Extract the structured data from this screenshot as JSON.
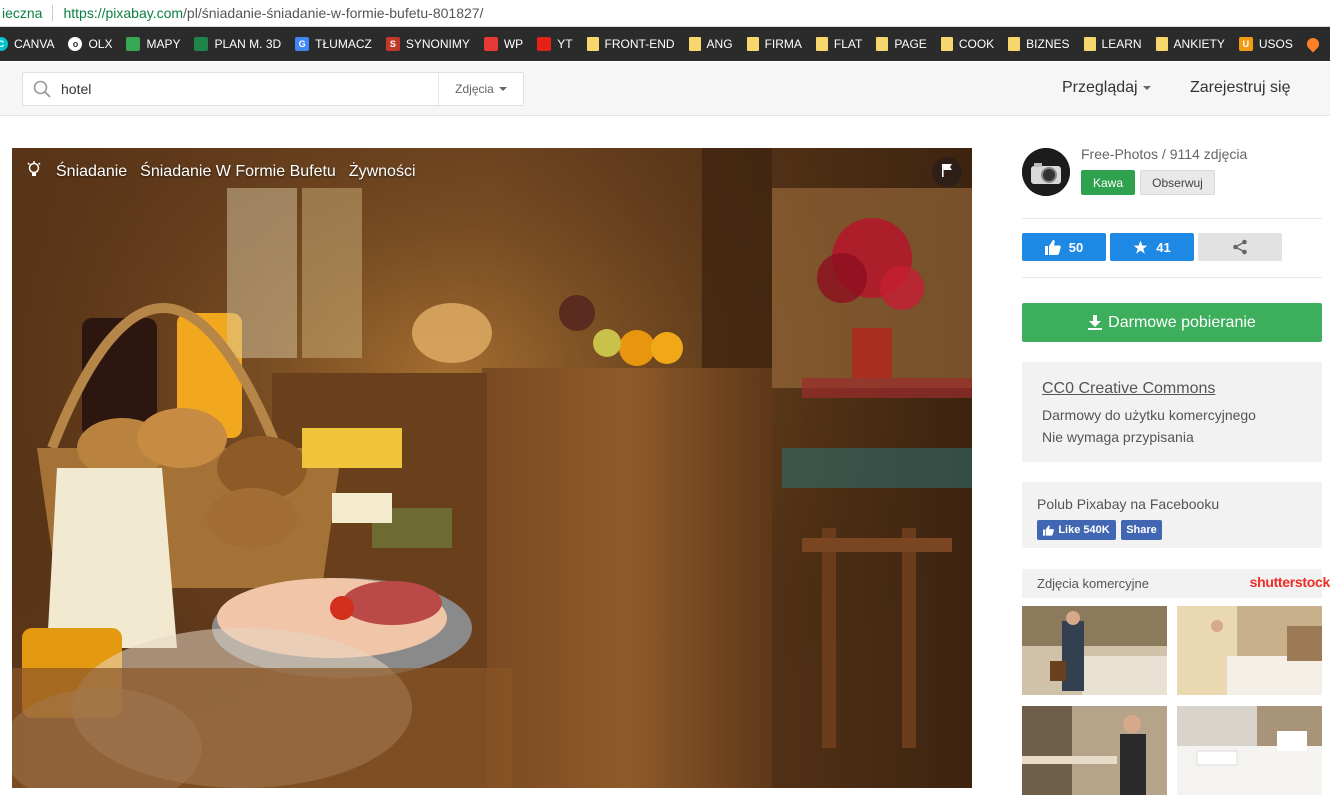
{
  "browser": {
    "security_fragment": "ieczna",
    "url_host": "https://pixabay.com",
    "url_path": "/pl/śniadanie-śniadanie-w-formie-bufetu-801827/"
  },
  "bookmarks": [
    {
      "label": "CANVA",
      "icon": "canva-icon",
      "color": "#00c4cc"
    },
    {
      "label": "OLX",
      "icon": "olx-icon",
      "color": "#ffffff"
    },
    {
      "label": "MAPY",
      "icon": "maps-icon",
      "color": "#34a853"
    },
    {
      "label": "PLAN M. 3D",
      "icon": "plan-icon",
      "color": "#1e8449"
    },
    {
      "label": "TŁUMACZ",
      "icon": "translate-icon",
      "color": "#4285f4"
    },
    {
      "label": "SYNONIMY",
      "icon": "synonimy-icon",
      "color": "#c0392b"
    },
    {
      "label": "WP",
      "icon": "wp-icon",
      "color": "#e53935"
    },
    {
      "label": "YT",
      "icon": "youtube-icon",
      "color": "#e62117"
    },
    {
      "label": "FRONT-END",
      "icon": "folder-icon"
    },
    {
      "label": "ANG",
      "icon": "folder-icon"
    },
    {
      "label": "FIRMA",
      "icon": "folder-icon"
    },
    {
      "label": "FLAT",
      "icon": "folder-icon"
    },
    {
      "label": "PAGE",
      "icon": "folder-icon"
    },
    {
      "label": "COOK",
      "icon": "folder-icon"
    },
    {
      "label": "BIZNES",
      "icon": "folder-icon"
    },
    {
      "label": "LEARN",
      "icon": "folder-icon"
    },
    {
      "label": "ANKIETY",
      "icon": "folder-icon"
    },
    {
      "label": "USOS",
      "icon": "usos-icon",
      "color": "#f39c12"
    }
  ],
  "search": {
    "query": "hotel",
    "type_label": "Zdjęcia"
  },
  "nav": {
    "browse": "Przeglądaj",
    "register": "Zarejestruj się"
  },
  "photo": {
    "tags": [
      "Śniadanie",
      "Śniadanie W Formie Bufetu",
      "Żywności"
    ]
  },
  "author": {
    "name_line": "Free-Photos / 9114 zdjęcia",
    "coffee_label": "Kawa",
    "follow_label": "Obserwuj"
  },
  "stats": {
    "likes": "50",
    "favorites": "41"
  },
  "download": {
    "label": "Darmowe pobieranie"
  },
  "license": {
    "title": "CC0 Creative Commons",
    "line1": "Darmowy do użytku komercyjnego",
    "line2": "Nie wymaga przypisania"
  },
  "facebook": {
    "title": "Polub Pixabay na Facebooku",
    "like_label": "Like 540K",
    "share_label": "Share"
  },
  "commercial": {
    "title": "Zdjęcia komercyjne",
    "brand": "shutterstock"
  },
  "colors": {
    "green": "#3cae5c",
    "blue": "#1e88e5",
    "accent_green": "#2ea24e"
  }
}
